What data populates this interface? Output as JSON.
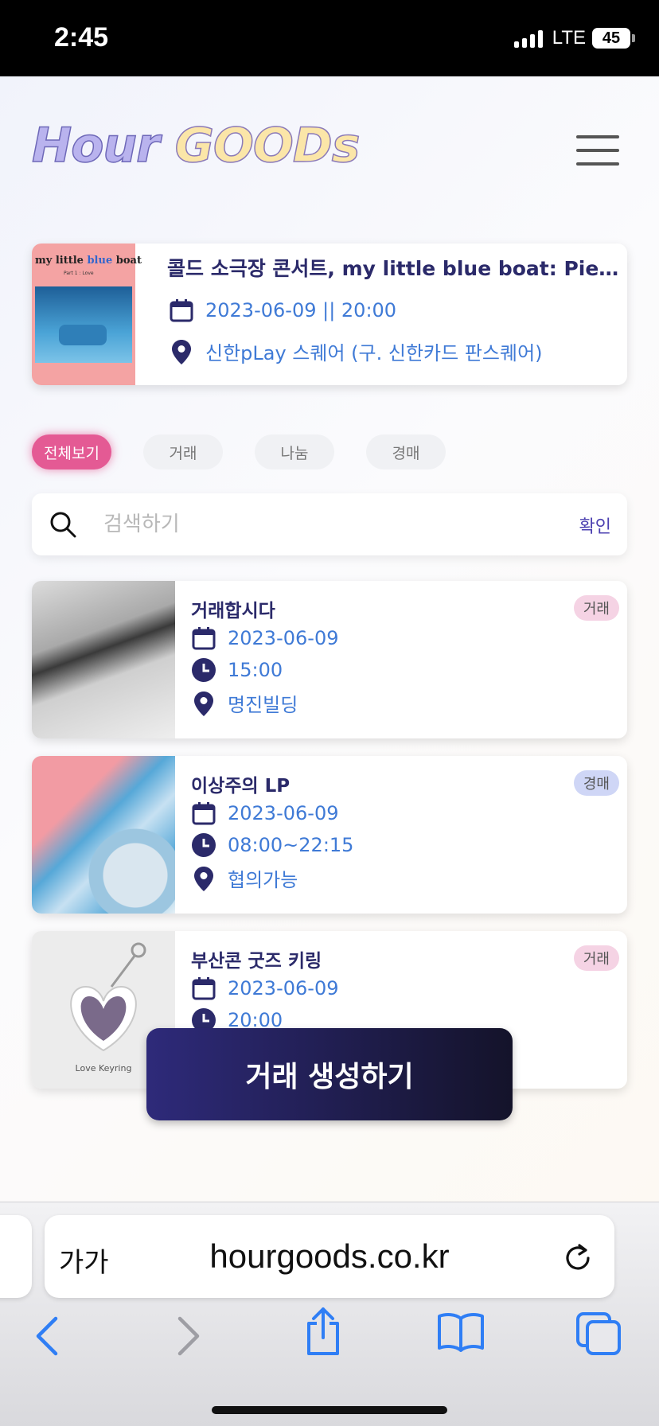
{
  "status": {
    "time": "2:45",
    "network": "LTE",
    "battery": "45"
  },
  "header": {
    "logo_part1": "Hour ",
    "logo_part2": "GOODs"
  },
  "concert": {
    "poster_title_1": "my little ",
    "poster_title_2": "blue",
    "poster_title_3": " boat",
    "poster_subtitle": "Part 1 : Love",
    "title": "콜드 소극장 콘서트, my little blue boat: Pie…",
    "datetime": "2023-06-09 || 20:00",
    "venue": "신한pLay 스퀘어 (구. 신한카드 판스퀘어)"
  },
  "tabs": [
    {
      "label": "전체보기",
      "active": true
    },
    {
      "label": "거래",
      "active": false
    },
    {
      "label": "나눔",
      "active": false
    },
    {
      "label": "경매",
      "active": false
    }
  ],
  "search": {
    "placeholder": "검색하기",
    "value": "",
    "confirm_label": "확인"
  },
  "trades": [
    {
      "title": "거래합시다",
      "badge": "거래",
      "badge_color": "#f5d3e4",
      "date": "2023-06-09",
      "time": "15:00",
      "place": "명진빌딩"
    },
    {
      "title": "이상주의 LP",
      "badge": "경매",
      "badge_color": "#cfd6f6",
      "date": "2023-06-09",
      "time": "08:00~22:15",
      "place": "협의가능"
    },
    {
      "title": "부산콘 굿즈 키링",
      "badge": "거래",
      "badge_color": "#f5d3e4",
      "date": "2023-06-09",
      "time": "20:00",
      "place": "",
      "thumb_caption": "Love Keyring"
    }
  ],
  "create_button": "거래 생성하기",
  "browser": {
    "aa": "가가",
    "url": "hourgoods.co.kr"
  },
  "colors": {
    "accent_pink": "#e45a94",
    "title_navy": "#2b2a6a",
    "info_blue": "#3f7ad6",
    "button_dark": "#1e1c4a"
  }
}
